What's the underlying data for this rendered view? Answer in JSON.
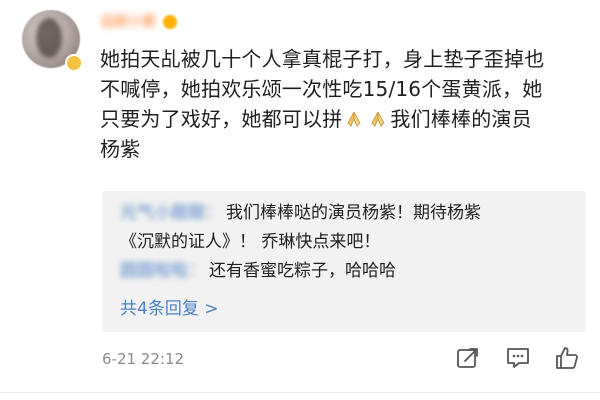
{
  "comment": {
    "username": "追剧小鹿",
    "text_line1": "她拍天乩被几十个人拿真棍子打，身上垫子歪掉也",
    "text_line2": "不喊停，她拍欢乐颂一次性吃15/16个蛋黄派，她",
    "text_line3_a": "只要为了戏好，她都可以拼",
    "text_line3_b": "我们棒棒的演员",
    "text_line4": "杨紫",
    "emoji_icon": "pray-hands-icon",
    "time": "6-21 22:12"
  },
  "replies": [
    {
      "name": "元气小甜甜：",
      "text_a": "我们棒棒哒的演员杨紫！期待杨紫",
      "text_b": "《沉默的证人》！ 乔琳快点来吧！"
    },
    {
      "name": "圆圆啦啦：",
      "text_a": "还有香蜜吃粽子，哈哈哈"
    }
  ],
  "more_replies": "共4条回复 >",
  "actions": [
    {
      "icon": "share-icon"
    },
    {
      "icon": "comment-icon"
    },
    {
      "icon": "like-icon"
    }
  ],
  "colors": {
    "link": "#4a82c6",
    "username": "#ff7a24",
    "quote_bg": "#f2f2f2",
    "muted": "#8a8a8a"
  }
}
